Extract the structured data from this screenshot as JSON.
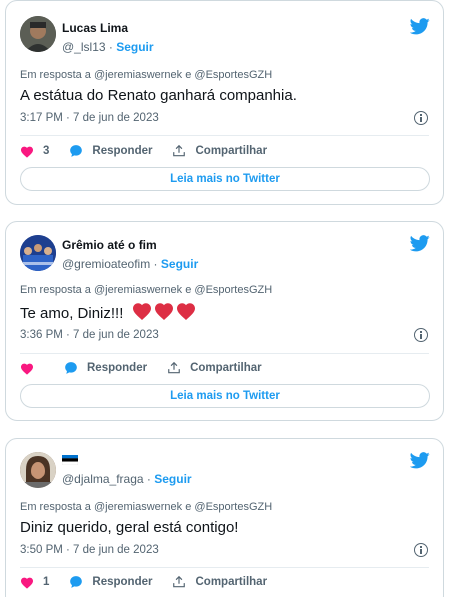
{
  "tweets": [
    {
      "name": "Lucas Lima",
      "handle": "@_lsl13",
      "follow": "Seguir",
      "reply_to": "Em resposta a @jeremiaswernek e @EsportesGZH",
      "text": "A estátua do Renato ganhará companhia.",
      "time": "3:17 PM · 7 de jun de 2023",
      "likes": "3",
      "reply_label": "Responder",
      "share_label": "Compartilhar",
      "read_more": "Leia mais no Twitter",
      "avatar_color": "#3b3f3a"
    },
    {
      "name": "Grêmio até o fim",
      "handle": "@gremioateofim",
      "follow": "Seguir",
      "reply_to": "Em resposta a @jeremiaswernek e @EsportesGZH",
      "text": "Te amo, Diniz!!!",
      "hearts": "❤️❤️❤️",
      "time": "3:36 PM · 7 de jun de 2023",
      "reply_label": "Responder",
      "share_label": "Compartilhar",
      "read_more": "Leia mais no Twitter",
      "avatar_color": "#2a4fa3"
    },
    {
      "name": "",
      "handle": "@djalma_fraga",
      "follow": "Seguir",
      "reply_to": "Em resposta a @jeremiaswernek e @EsportesGZH",
      "text": "Diniz querido, geral está contigo!",
      "time": "3:50 PM · 7 de jun de 2023",
      "likes": "1",
      "reply_label": "Responder",
      "share_label": "Compartilhar",
      "avatar_color": "#7a5a45"
    }
  ],
  "colors": {
    "brand": "#1d9bf0",
    "like": "#f91880",
    "text": "#0f1419",
    "muted": "#536471"
  },
  "icons": {
    "bird": "twitter-bird-icon",
    "like": "heart-icon",
    "reply": "speech-bubble-icon",
    "share": "share-icon",
    "info": "info-icon",
    "flag": "estonia-flag-icon"
  }
}
